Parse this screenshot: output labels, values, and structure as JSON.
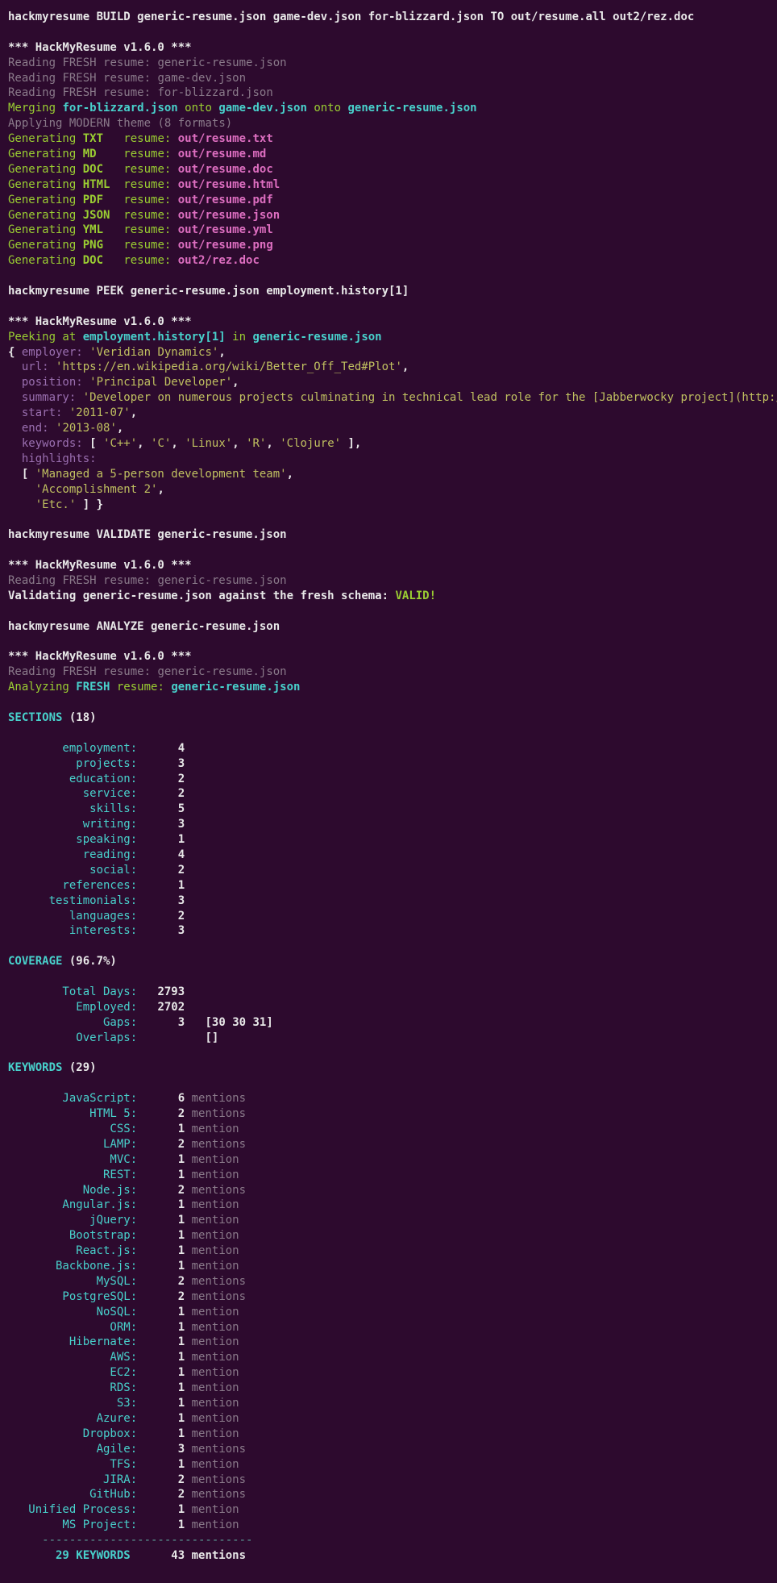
{
  "cmd": {
    "build": "hackmyresume BUILD generic-resume.json game-dev.json for-blizzard.json TO out/resume.all out2/rez.doc",
    "peek": "hackmyresume PEEK generic-resume.json employment.history[1]",
    "validate": "hackmyresume VALIDATE generic-resume.json",
    "analyze": "hackmyresume ANALYZE generic-resume.json"
  },
  "banner": "*** HackMyResume v1.6.0 ***",
  "reading": {
    "prefix": "Reading ",
    "fresh": "FRESH",
    "resume": " resume: ",
    "f1": "generic-resume.json",
    "f2": "game-dev.json",
    "f3": "for-blizzard.json"
  },
  "merge": {
    "prefix": "Merging ",
    "onto": " onto ",
    "a": "for-blizzard.json",
    "b": "game-dev.json",
    "c": "generic-resume.json"
  },
  "apply": {
    "prefix": "Applying ",
    "theme": "MODERN",
    "suffix": " theme (",
    "count": "8",
    "end": " formats)"
  },
  "gen": {
    "word": "Generating ",
    "resume": "resume: ",
    "rows": [
      {
        "fmt": "TXT",
        "pad": "  ",
        "out": "out/resume.txt"
      },
      {
        "fmt": "MD",
        "pad": "   ",
        "out": "out/resume.md"
      },
      {
        "fmt": "DOC",
        "pad": "  ",
        "out": "out/resume.doc"
      },
      {
        "fmt": "HTML",
        "pad": " ",
        "out": "out/resume.html"
      },
      {
        "fmt": "PDF",
        "pad": "  ",
        "out": "out/resume.pdf"
      },
      {
        "fmt": "JSON",
        "pad": " ",
        "out": "out/resume.json"
      },
      {
        "fmt": "YML",
        "pad": "  ",
        "out": "out/resume.yml"
      },
      {
        "fmt": "PNG",
        "pad": "  ",
        "out": "out/resume.png"
      },
      {
        "fmt": "DOC",
        "pad": "  ",
        "out": "out2/rez.doc"
      }
    ]
  },
  "peek": {
    "prefix": "Peeking at ",
    "path": "employment.history[1]",
    "in": " in ",
    "file": "generic-resume.json"
  },
  "obj": {
    "lbrace": "{ ",
    "employerK": "employer:",
    "employerV": "'Veridian Dynamics'",
    "urlK": "url:",
    "urlV": "'https://en.wikipedia.org/wiki/Better_Off_Ted#Plot'",
    "positionK": "position:",
    "positionV": "'Principal Developer'",
    "summaryK": "summary:",
    "summaryV": "'Developer on numerous projects culminating in technical lead role for the [Jabberwocky project](http://betteroffted.wikia.com/wiki/Jabberwocky) and promotion to principal developer.'",
    "startK": "start:",
    "startV": "'2011-07'",
    "endK": "end:",
    "endV": "'2013-08'",
    "keywordsK": "keywords:",
    "kw": [
      "'C++'",
      "'C'",
      "'Linux'",
      "'R'",
      "'Clojure'"
    ],
    "highlightsK": "highlights:",
    "hl": [
      "'Managed a 5-person development team'",
      "'Accomplishment 2'",
      "'Etc.'"
    ]
  },
  "validate": {
    "prefix": "Validating ",
    "file": "generic-resume.json",
    "mid": " against the ",
    "schema": "fresh",
    "suffix": " schema: ",
    "result": "VALID!"
  },
  "analyze": {
    "prefix": "Analyzing ",
    "fresh": "FRESH",
    "mid": " resume: ",
    "file": "generic-resume.json"
  },
  "sections": {
    "title": "SECTIONS ",
    "count": "(18)",
    "rows": [
      [
        "employment",
        "4"
      ],
      [
        "projects",
        "3"
      ],
      [
        "education",
        "2"
      ],
      [
        "service",
        "2"
      ],
      [
        "skills",
        "5"
      ],
      [
        "writing",
        "3"
      ],
      [
        "speaking",
        "1"
      ],
      [
        "reading",
        "4"
      ],
      [
        "social",
        "2"
      ],
      [
        "references",
        "1"
      ],
      [
        "testimonials",
        "3"
      ],
      [
        "languages",
        "2"
      ],
      [
        "interests",
        "3"
      ]
    ]
  },
  "coverage": {
    "title": "COVERAGE ",
    "pct": "(96.7%)",
    "totalL": "Total Days:",
    "totalV": "2793",
    "empL": "Employed:",
    "empV": "2702",
    "gapsL": "Gaps:",
    "gapsV": "3",
    "gapsArr": "30 30 31",
    "ovlL": "Overlaps:",
    "ovlArr": "[]"
  },
  "keywords": {
    "title": "KEYWORDS ",
    "count": "(29)",
    "plural": "mentions",
    "singular": "mention",
    "rows": [
      [
        "JavaScript",
        "6",
        "mentions"
      ],
      [
        "HTML 5",
        "2",
        "mentions"
      ],
      [
        "CSS",
        "1",
        "mention"
      ],
      [
        "LAMP",
        "2",
        "mentions"
      ],
      [
        "MVC",
        "1",
        "mention"
      ],
      [
        "REST",
        "1",
        "mention"
      ],
      [
        "Node.js",
        "2",
        "mentions"
      ],
      [
        "Angular.js",
        "1",
        "mention"
      ],
      [
        "jQuery",
        "1",
        "mention"
      ],
      [
        "Bootstrap",
        "1",
        "mention"
      ],
      [
        "React.js",
        "1",
        "mention"
      ],
      [
        "Backbone.js",
        "1",
        "mention"
      ],
      [
        "MySQL",
        "2",
        "mentions"
      ],
      [
        "PostgreSQL",
        "2",
        "mentions"
      ],
      [
        "NoSQL",
        "1",
        "mention"
      ],
      [
        "ORM",
        "1",
        "mention"
      ],
      [
        "Hibernate",
        "1",
        "mention"
      ],
      [
        "AWS",
        "1",
        "mention"
      ],
      [
        "EC2",
        "1",
        "mention"
      ],
      [
        "RDS",
        "1",
        "mention"
      ],
      [
        "S3",
        "1",
        "mention"
      ],
      [
        "Azure",
        "1",
        "mention"
      ],
      [
        "Dropbox",
        "1",
        "mention"
      ],
      [
        "Agile",
        "3",
        "mentions"
      ],
      [
        "TFS",
        "1",
        "mention"
      ],
      [
        "JIRA",
        "2",
        "mentions"
      ],
      [
        "GitHub",
        "2",
        "mentions"
      ],
      [
        "Unified Process",
        "1",
        "mention"
      ],
      [
        "MS Project",
        "1",
        "mention"
      ]
    ],
    "dashes": "     -------------------------------",
    "totL": "29 KEYWORDS",
    "totR": "43",
    "totW": "mentions"
  }
}
